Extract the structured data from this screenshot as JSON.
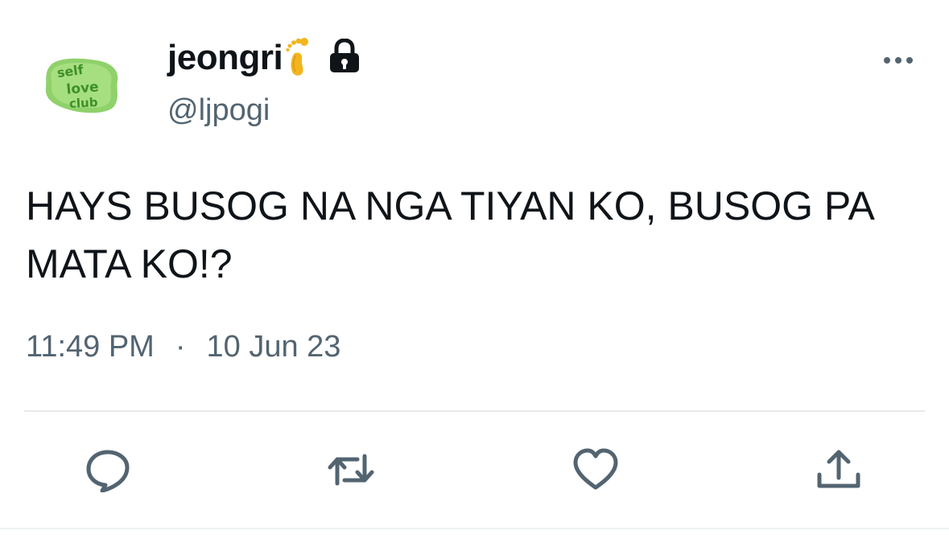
{
  "author": {
    "display_name": "jeongri",
    "handle": "@ljpogi",
    "avatar_text": [
      "self",
      "love",
      "club"
    ],
    "name_emoji": "foot-icon",
    "verified_lock": "lock-icon"
  },
  "tweet": {
    "text": "HAYS BUSOG NA NGA TIYAN KO, BUSOG PA\nMATA KO!?",
    "time": "11:49 PM",
    "separator": "·",
    "date": "10 Jun 23"
  },
  "actions": {
    "reply": "comment-icon",
    "retweet": "retweet-icon",
    "like": "heart-icon",
    "share": "share-icon"
  },
  "colors": {
    "text": "#0f1419",
    "secondary": "#536471",
    "avatar_green": "#8fd16a",
    "avatar_dark_green": "#3f8f2a",
    "divider": "#e7e9ec"
  }
}
